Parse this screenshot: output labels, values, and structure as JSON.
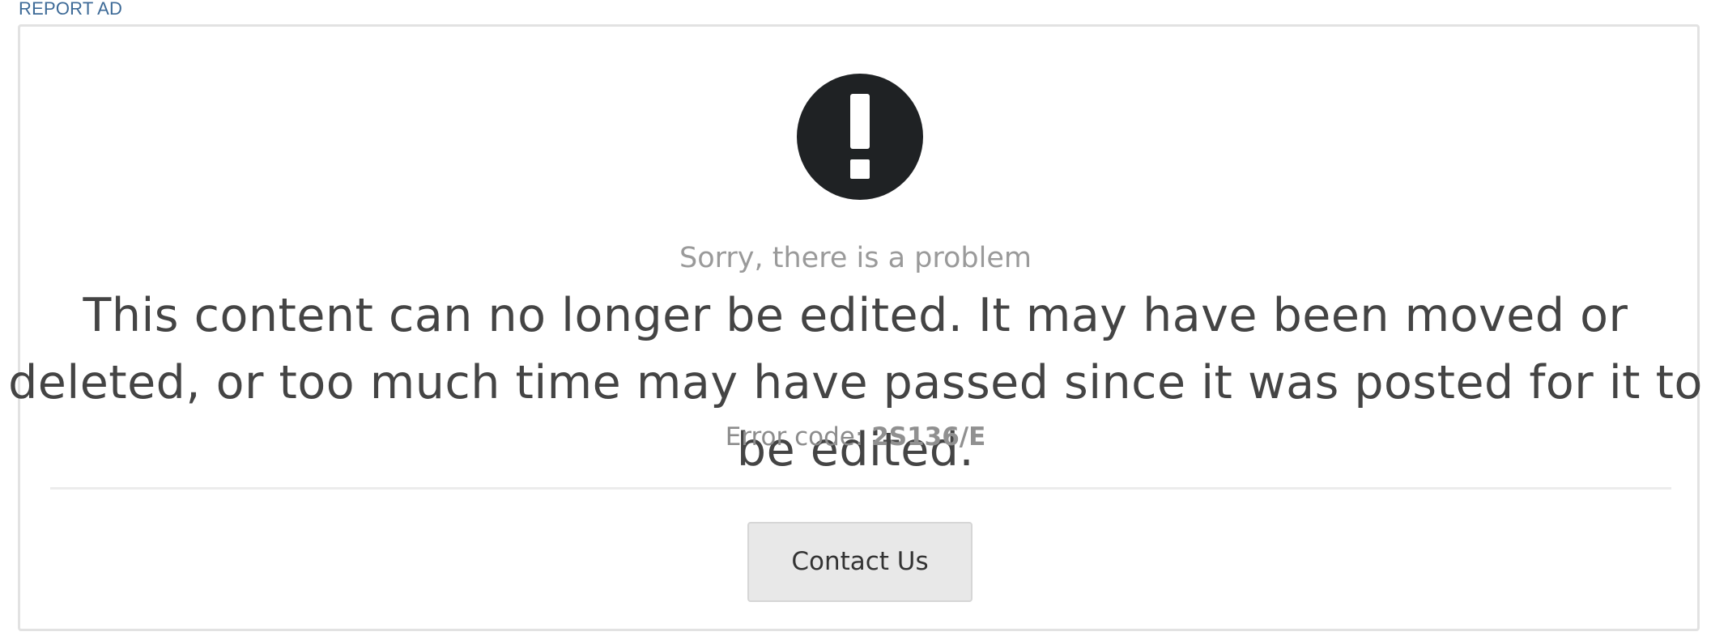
{
  "header": {
    "report_ad_label": "REPORT AD"
  },
  "error_panel": {
    "icon": "exclamation-circle-icon",
    "subtitle": "Sorry, there is a problem",
    "message": "This content can no longer be edited. It may have been moved or deleted, or too much time may have passed since it was posted for it to be edited.",
    "error_code_label": "Error code: ",
    "error_code_value": "2S136/E",
    "contact_button_label": "Contact Us"
  },
  "colors": {
    "link": "#3d6a97",
    "icon": "#1f2224",
    "subtitle": "#9a9a9a",
    "message": "#444444",
    "button_bg": "#e8e8e8"
  }
}
